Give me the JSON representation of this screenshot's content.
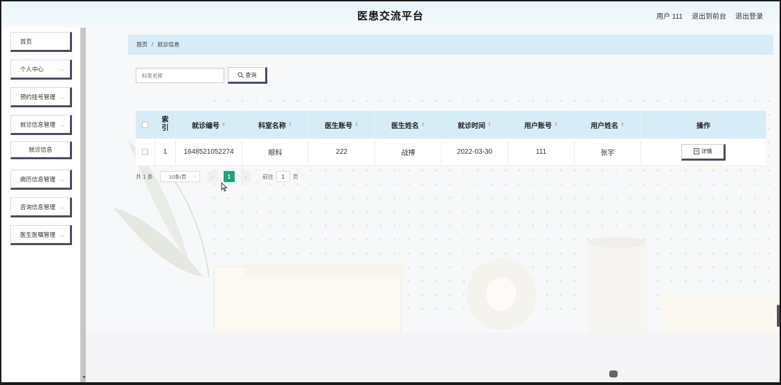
{
  "header": {
    "title": "医患交流平台",
    "user": "用户 111",
    "back_front": "退出到前台",
    "logout": "退出登录"
  },
  "sidebar": {
    "items": [
      {
        "label": "首页",
        "has_chevron": false
      },
      {
        "label": "个人中心",
        "has_chevron": true
      },
      {
        "label": "预约挂号管理",
        "has_chevron": true
      },
      {
        "label": "就诊信息管理",
        "has_chevron": true
      },
      {
        "label": "就诊信息",
        "sub": true
      },
      {
        "label": "病历信息管理",
        "has_chevron": true
      },
      {
        "label": "咨询信息管理",
        "has_chevron": true
      },
      {
        "label": "医生医嘱管理",
        "has_chevron": true
      }
    ]
  },
  "breadcrumb": {
    "home": "首页",
    "separator": "/",
    "current": "就诊信息"
  },
  "search": {
    "placeholder": "科室名称",
    "button_label": "查询"
  },
  "table": {
    "columns": [
      "索引",
      "就诊编号",
      "科室名称",
      "医生账号",
      "医生姓名",
      "就诊时间",
      "用户账号",
      "用户姓名",
      "操作"
    ],
    "rows": [
      {
        "index": "1",
        "visit_no": "1648521052274",
        "department": "眼科",
        "doctor_account": "222",
        "doctor_name": "战搏",
        "visit_time": "2022-03-30",
        "user_account": "111",
        "user_name": "张宇",
        "action": "详情"
      }
    ]
  },
  "pager": {
    "total": "共 1 条",
    "page_size": "10条/页",
    "current_page": "1",
    "goto_label": "前往",
    "goto_value": "1",
    "page_unit": "页"
  },
  "colors": {
    "header_bg": "#eaf6fc",
    "table_header_bg": "#d6edf8",
    "active_page": "#1fa37d",
    "button_shadow": "#4a4a6a"
  }
}
